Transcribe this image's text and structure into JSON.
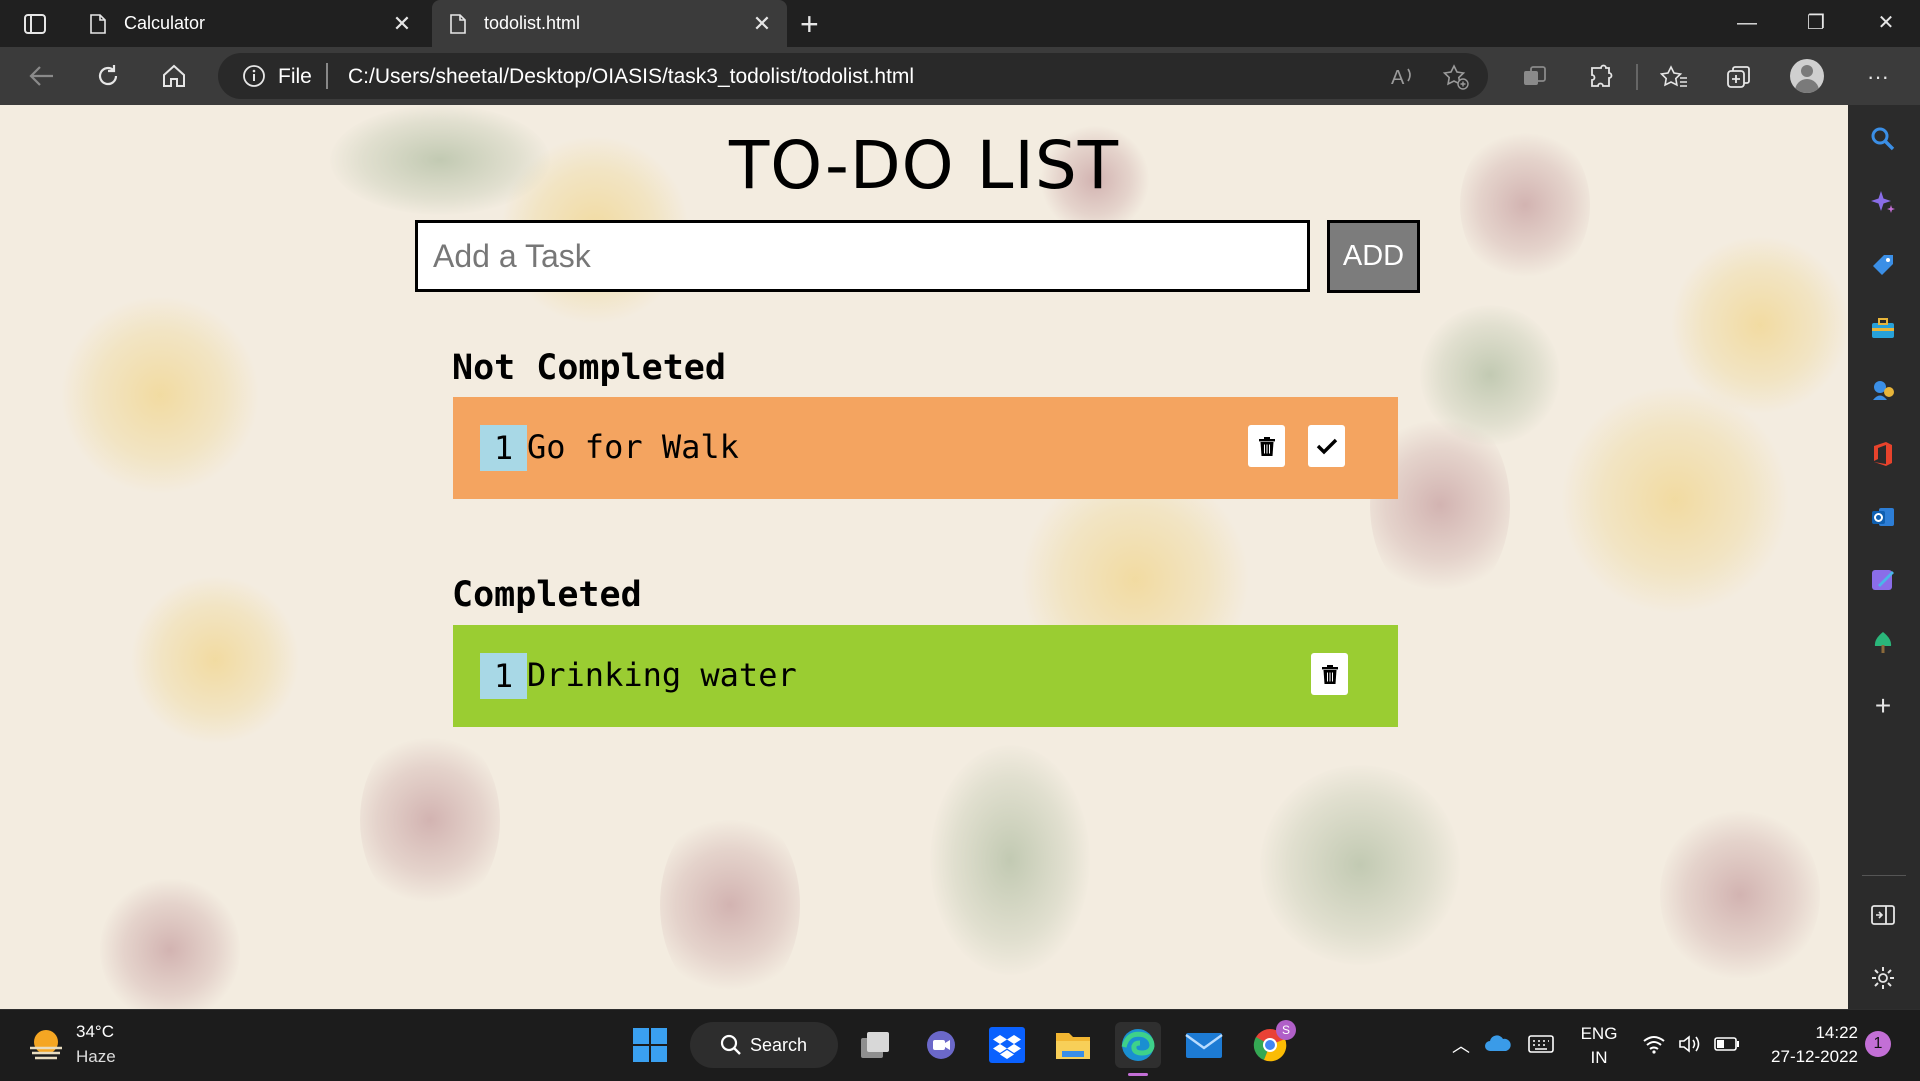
{
  "browser": {
    "tabs": [
      {
        "label": "Calculator"
      },
      {
        "label": "todolist.html"
      }
    ],
    "address": {
      "scheme_label": "File",
      "url": "C:/Users/sheetal/Desktop/OIASIS/task3_todolist/todolist.html"
    }
  },
  "page": {
    "title": "TO-DO LIST",
    "input_placeholder": "Add a Task",
    "add_label": "ADD",
    "not_completed": {
      "heading": "Not Completed",
      "tasks": [
        {
          "num": "1",
          "text": "Go for Walk"
        }
      ]
    },
    "completed": {
      "heading": "Completed",
      "tasks": [
        {
          "num": "1",
          "text": "Drinking water"
        }
      ]
    },
    "colors": {
      "not_completed_row": "#f4a460",
      "completed_row": "#9acd32",
      "number_badge": "#a8d8e6",
      "add_button": "#7c7c7c"
    }
  },
  "taskbar": {
    "weather": {
      "temp": "34°C",
      "desc": "Haze"
    },
    "search_label": "Search",
    "language": {
      "lang": "ENG",
      "region": "IN"
    },
    "clock": {
      "time": "14:22",
      "date": "27-12-2022"
    },
    "notification_count": "1",
    "chrome_badge": "S"
  }
}
